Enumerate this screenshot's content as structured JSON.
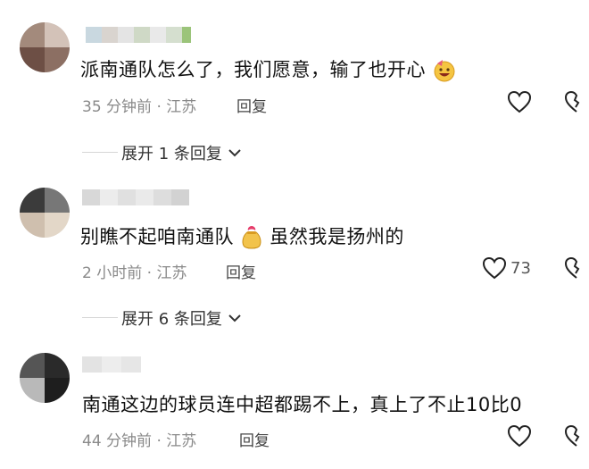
{
  "comments": [
    {
      "text": "派南通队怎么了，我们愿意，输了也开心",
      "time": "35 分钟前",
      "location": "江苏",
      "reply_label": "回复",
      "like_count": "",
      "expand_label": "展开 1 条回复",
      "emoji": "grinning-face-with-party-icon"
    },
    {
      "text_before": "别瞧不起咱南通队",
      "text_after": "虽然我是扬州的",
      "time": "2 小时前",
      "location": "江苏",
      "reply_label": "回复",
      "like_count": "73",
      "expand_label": "展开 6 条回复",
      "emoji": "money-bag-heart-icon"
    },
    {
      "text": "南通这边的球员连中超都踢不上，真上了不止10比0",
      "time": "44 分钟前",
      "location": "江苏",
      "reply_label": "回复",
      "like_count": ""
    }
  ],
  "separator": "·",
  "colors": {
    "meta": "#8a8a8a",
    "text": "#111111",
    "background": "#ffffff"
  }
}
